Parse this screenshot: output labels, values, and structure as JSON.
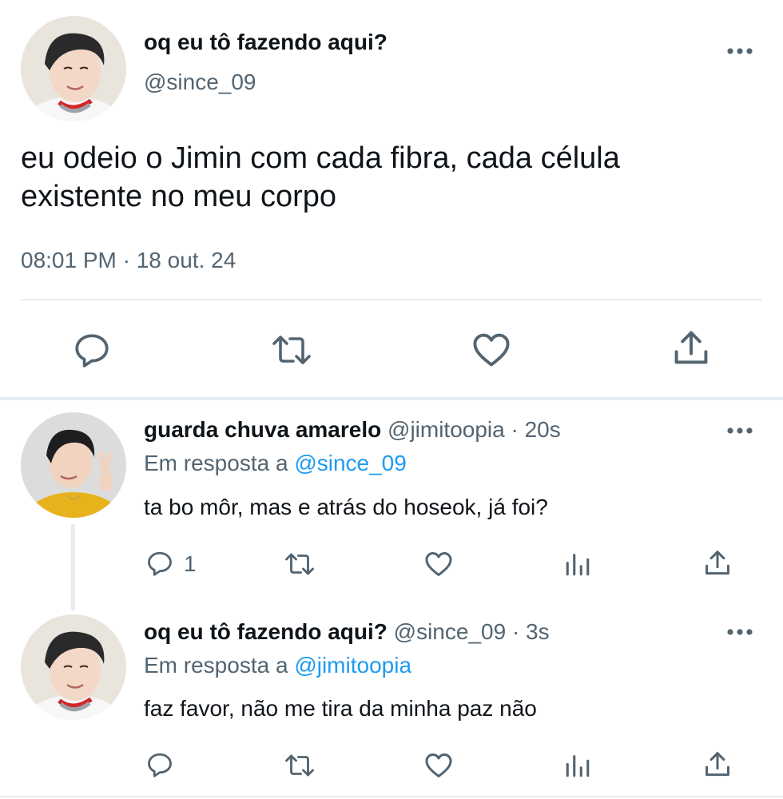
{
  "main_tweet": {
    "display_name": "oq eu tô fazendo aqui?",
    "handle": "@since_09",
    "text": "eu odeio o Jimin com cada fibra, cada célula existente no meu corpo",
    "timestamp": "08:01 PM · 18 out. 24",
    "more_icon": "more-horizontal-icon",
    "actions": [
      "reply-icon",
      "retweet-icon",
      "like-icon",
      "share-icon"
    ]
  },
  "replies": [
    {
      "display_name": "guarda chuva amarelo",
      "handle_time": "@jimitoopia · 20s",
      "reply_prefix": "Em resposta a",
      "reply_to": "@since_09",
      "text": "ta bo môr, mas e atrás do hoseok, já foi?",
      "reply_count": "1"
    },
    {
      "display_name": "oq eu tô fazendo aqui?",
      "handle_time": "@since_09 · 3s",
      "reply_prefix": "Em resposta a",
      "reply_to": "@jimitoopia",
      "text": "faz favor, não me tira da minha paz não",
      "reply_count": ""
    }
  ],
  "colors": {
    "text": "#0f1419",
    "secondary": "#536471",
    "link": "#1d9bf0",
    "divider": "#e6ebef"
  }
}
